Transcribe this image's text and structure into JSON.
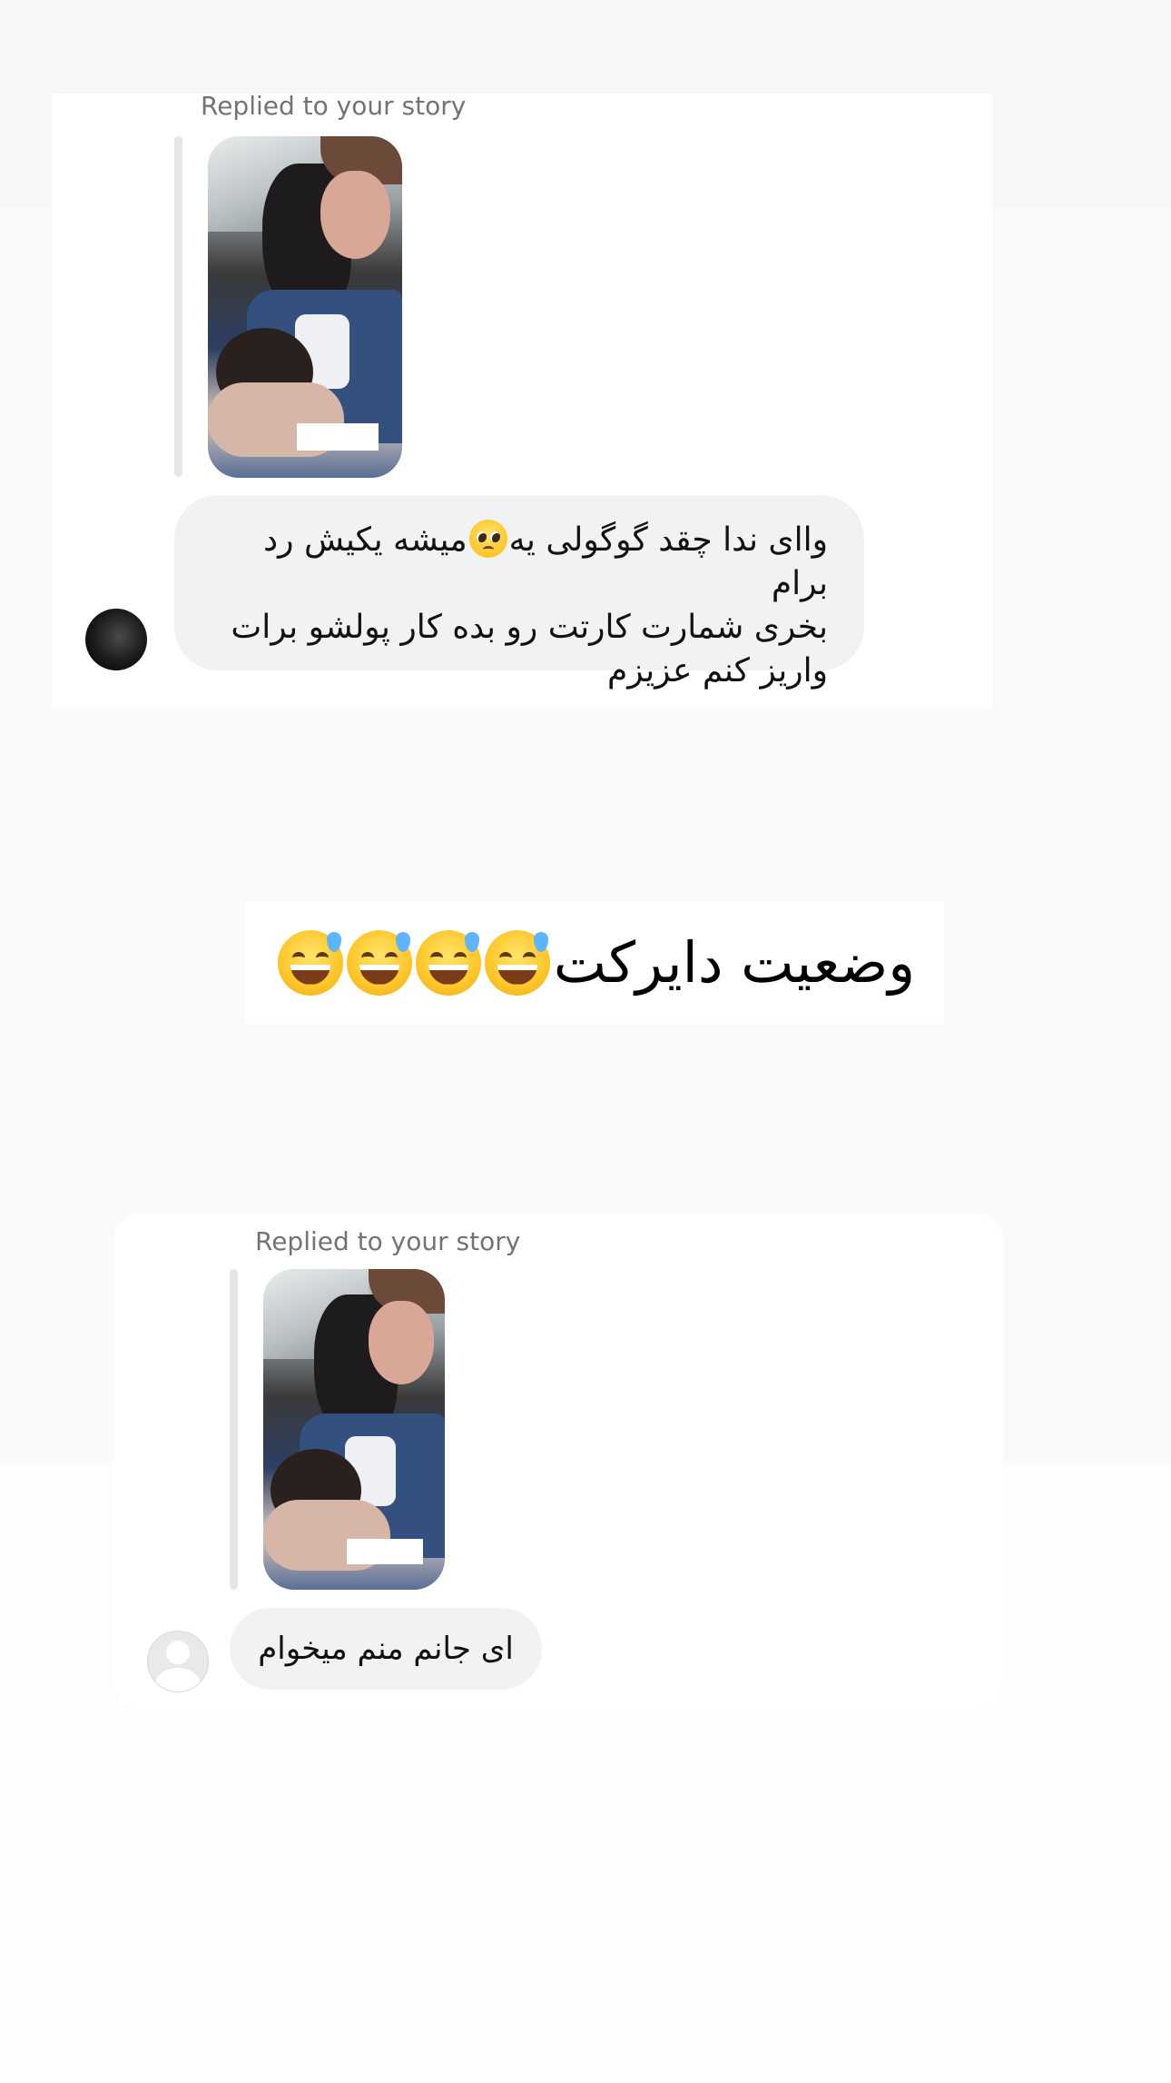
{
  "top_screenshot": {
    "replied_label": "Replied to your story",
    "message_line1_before_emoji": "واای ندا چقد گوگولی یه",
    "message_emoji": "pleading-face-emoji",
    "message_line1_after_emoji": "میشه یکیش رد برام",
    "message_line2": "بخری شمارت کارتت رو بده کار پولشو برات",
    "message_line3": "واریز کنم عزیزم"
  },
  "caption": {
    "text": "وضعیت دایرکت",
    "emoji": "grinning-face-with-sweat-emoji",
    "emoji_count": 4
  },
  "bottom_screenshot": {
    "replied_label": "Replied to your story",
    "message": "ای جانم منم میخوام"
  },
  "colors": {
    "bubble": "#f1f2f4",
    "label": "#737373",
    "story_bar": "#e6e6e6"
  }
}
